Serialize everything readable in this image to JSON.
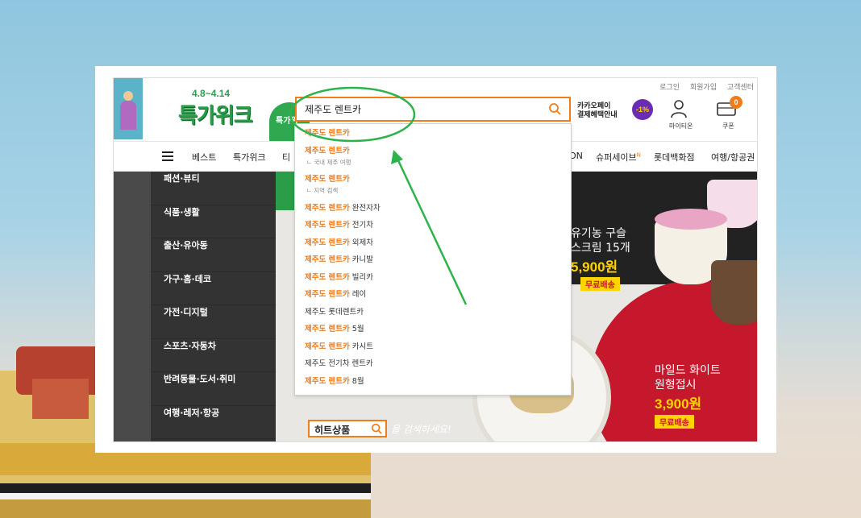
{
  "header": {
    "promo_dates": "4.8~4.14",
    "promo_title": "특가위크",
    "promo_badge": "특가위",
    "top_links": [
      "로그인",
      "회원가입",
      "고객센터"
    ],
    "search_value": "제주도 렌트카",
    "kakao_line1": "카카오페이",
    "kakao_line2": "결제혜택안내",
    "pct_badge": "-1%",
    "my_label": "마이티온",
    "cart_label": "쿠폰",
    "cart_count": "0"
  },
  "nav": {
    "items": [
      {
        "label": "베스트"
      },
      {
        "label": "특가위크"
      },
      {
        "label": "티"
      },
      {
        "label": "ON"
      },
      {
        "label": "슈퍼세이브",
        "sup": "N"
      },
      {
        "label": "롯데백화점"
      },
      {
        "label": "여행/항공권"
      }
    ]
  },
  "categories": [
    "패션·뷰티",
    "식품·생활",
    "출산·유아동",
    "가구·홈·데코",
    "가전·디지털",
    "스포츠·자동차",
    "반려동물·도서·취미",
    "여행·레저·항공"
  ],
  "dropdown": {
    "items": [
      {
        "hl": "제주도 렌트카",
        "rest": "",
        "sub": ""
      },
      {
        "hl": "제주도 렌트카",
        "rest": "",
        "sub": "ㄴ 국내 제주 여행"
      },
      {
        "hl": "제주도 렌트카",
        "rest": "",
        "sub": "ㄴ 지역 검색"
      },
      {
        "hl": "제주도 렌트카",
        "rest": " 완전자차",
        "sub": ""
      },
      {
        "hl": "제주도 렌트카",
        "rest": " 전기차",
        "sub": ""
      },
      {
        "hl": "제주도 렌트카",
        "rest": " 외제차",
        "sub": ""
      },
      {
        "hl": "제주도 렌트카",
        "rest": " 카니발",
        "sub": ""
      },
      {
        "hl": "제주도 렌트카",
        "rest": " 빌리카",
        "sub": ""
      },
      {
        "hl": "제주도 렌트카",
        "rest": " 레이",
        "sub": ""
      },
      {
        "hl": "",
        "rest": "제주도 롯데렌트카",
        "sub": ""
      },
      {
        "hl": "제주도 렌트카",
        "rest": " 5월",
        "sub": ""
      },
      {
        "hl": "제주도 렌트카",
        "rest": " 카시트",
        "sub": ""
      },
      {
        "hl": "",
        "rest": "제주도 전기차 렌트카",
        "sub": ""
      },
      {
        "hl": "제주도 렌트카",
        "rest": " 8월",
        "sub": ""
      }
    ]
  },
  "banner": {
    "text1": "유기농 구슬\n스크림 15개",
    "price1": "5,900원",
    "ship1": "무료배송",
    "text2": "마일드 화이트\n원형접시",
    "price2": "3,900원",
    "ship2": "무료배송",
    "hit_label": "히트상품",
    "hit_tail": "을 검색하세요!"
  },
  "colors": {
    "accent": "#f07d1a",
    "annotation": "#2db34a",
    "category_bg": "#333333"
  }
}
